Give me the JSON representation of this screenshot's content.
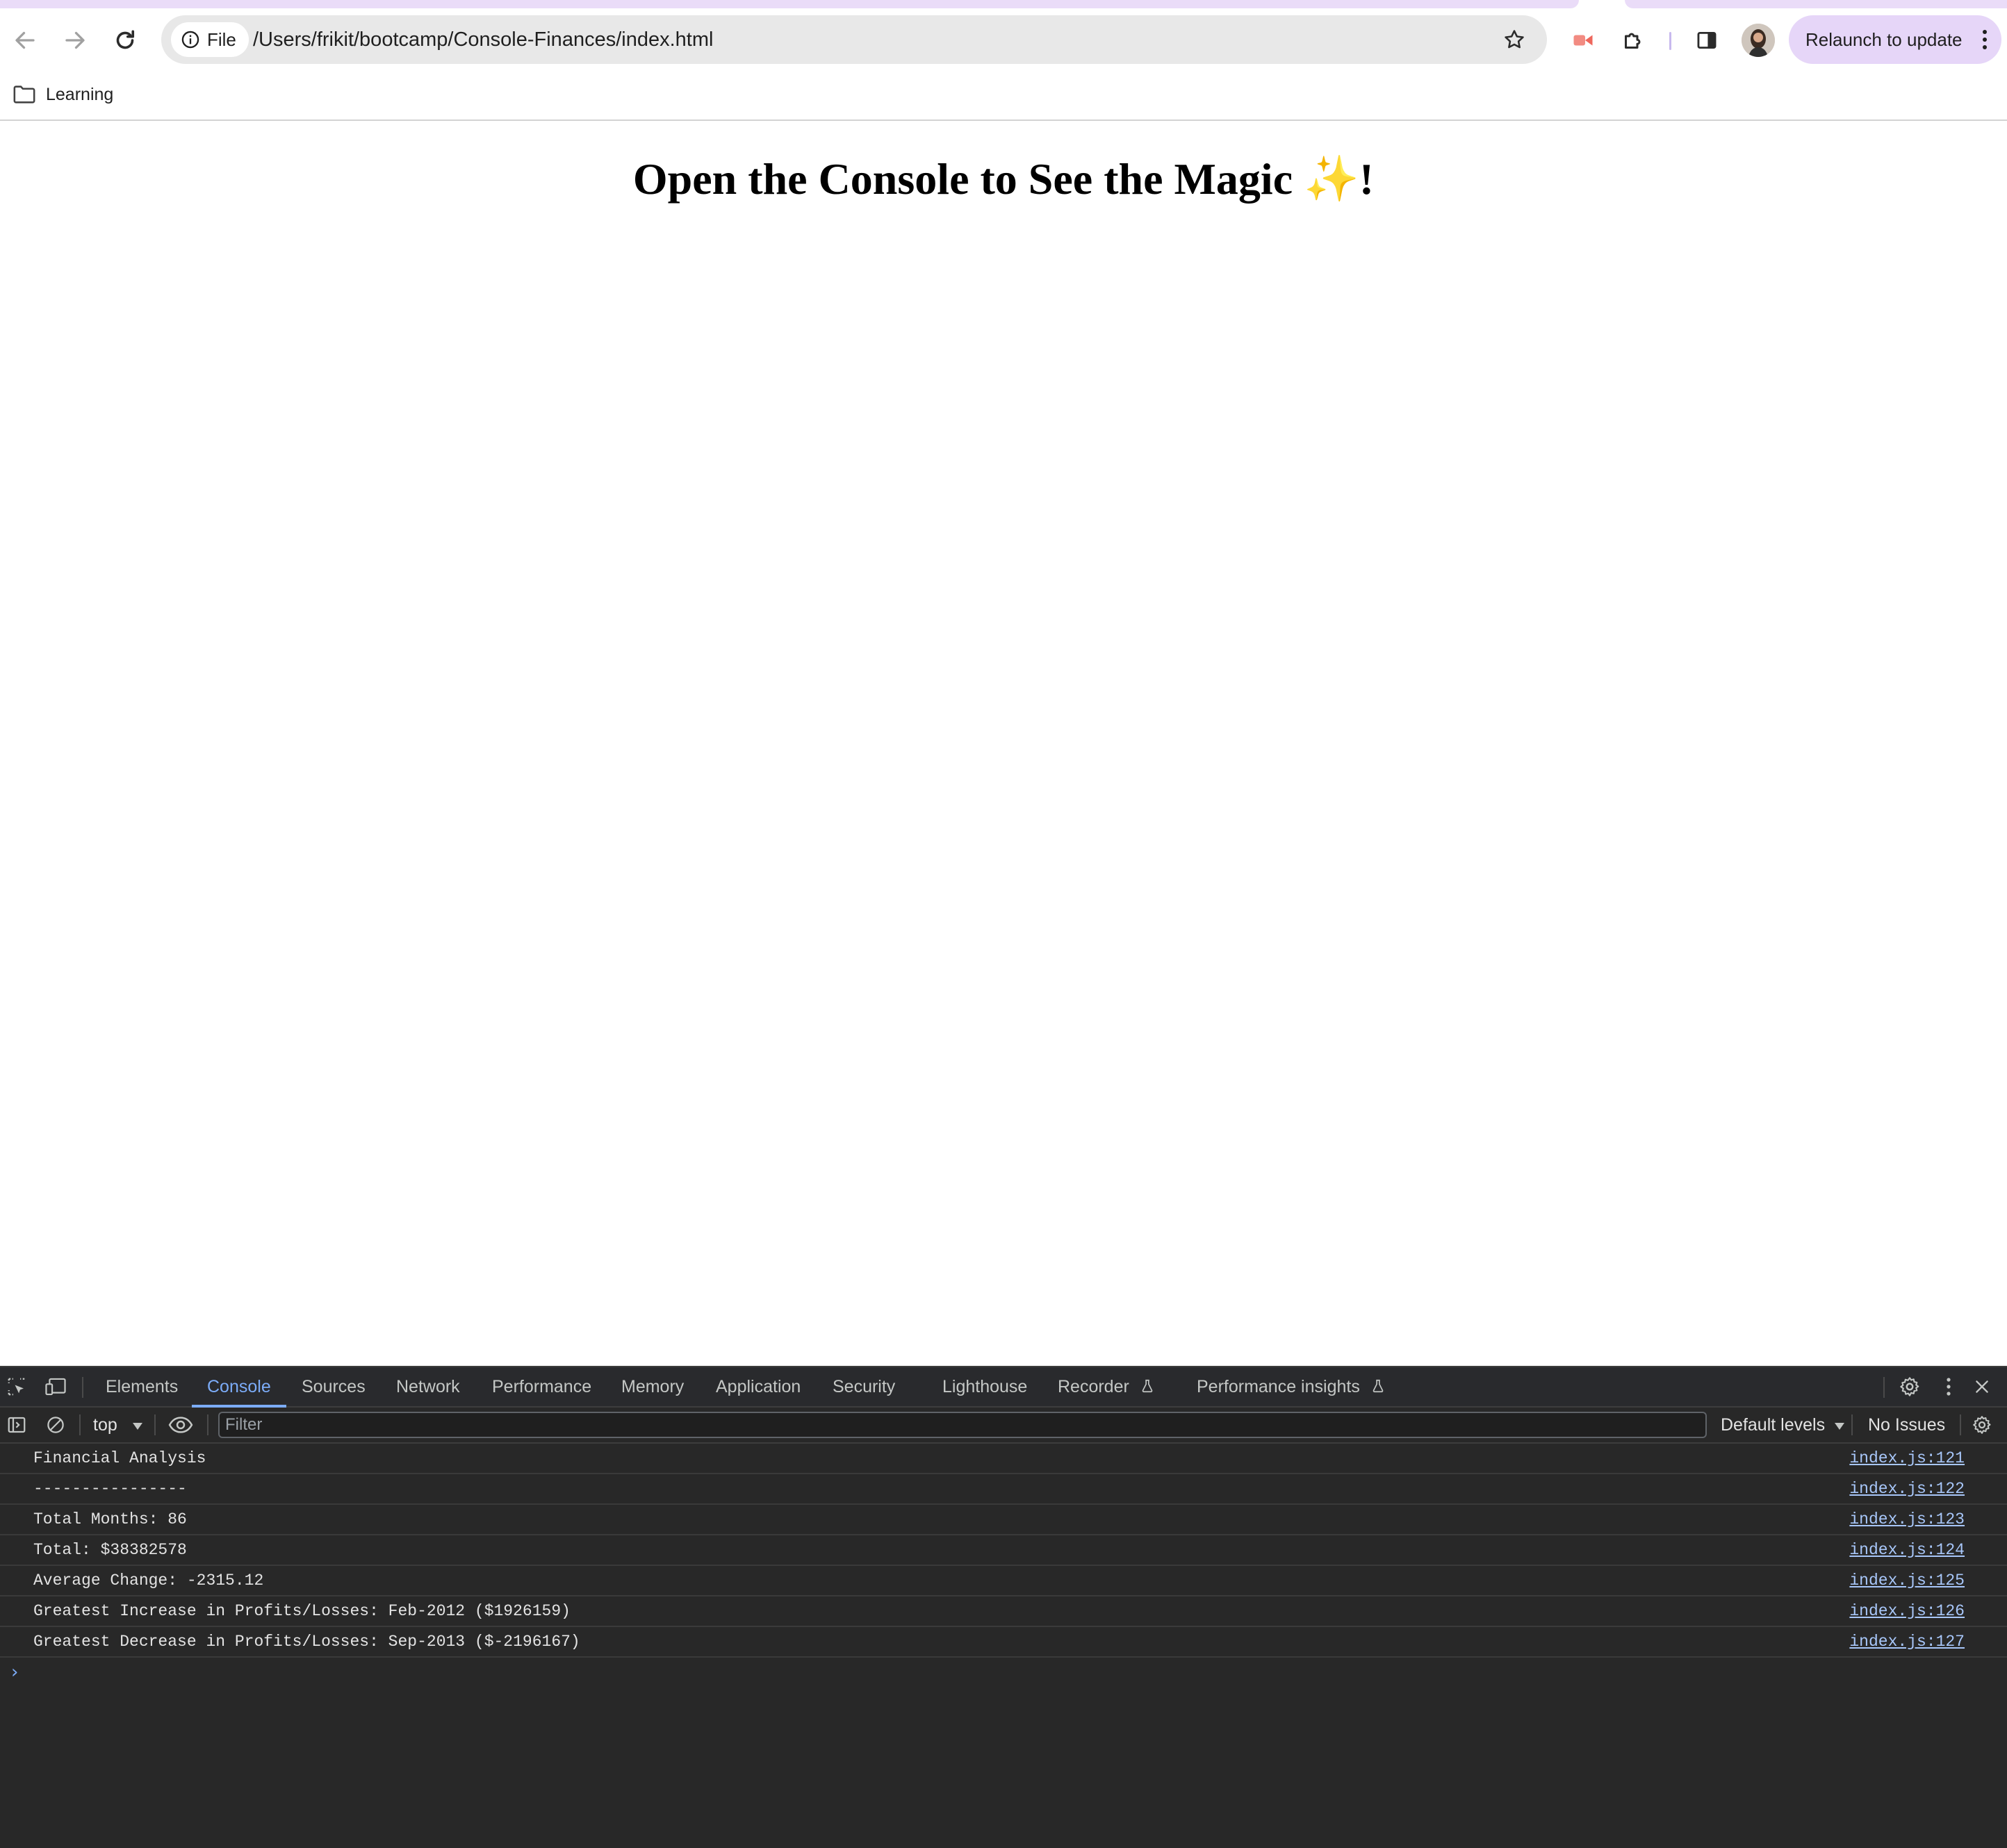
{
  "browser": {
    "site_info_label": "File",
    "url": "/Users/frikit/bootcamp/Console-Finances/index.html",
    "relaunch_label": "Relaunch to update",
    "bookmarks": [
      {
        "label": "Learning",
        "icon": "folder-icon"
      }
    ],
    "colors": {
      "accent": "#e6d6f8",
      "omnibox": "#e8e8e8"
    }
  },
  "page": {
    "heading_text": "Open the Console to See the Magic ",
    "heading_emoji": "✨",
    "heading_end": "!"
  },
  "devtools": {
    "tabs": [
      {
        "label": "Elements"
      },
      {
        "label": "Console",
        "active": true
      },
      {
        "label": "Sources"
      },
      {
        "label": "Network"
      },
      {
        "label": "Performance"
      },
      {
        "label": "Memory"
      },
      {
        "label": "Application"
      },
      {
        "label": "Security"
      },
      {
        "label": "Lighthouse"
      },
      {
        "label": "Recorder"
      },
      {
        "label": "Performance insights"
      }
    ],
    "context": "top",
    "filter_placeholder": "Filter",
    "levels": "Default levels",
    "issues": "No Issues",
    "console_rows": [
      {
        "message": "Financial Analysis",
        "source": "index.js:121"
      },
      {
        "message": "----------------",
        "source": "index.js:122"
      },
      {
        "message": "Total Months: 86",
        "source": "index.js:123"
      },
      {
        "message": "Total: $38382578",
        "source": "index.js:124"
      },
      {
        "message": "Average Change: -2315.12",
        "source": "index.js:125"
      },
      {
        "message": "Greatest Increase in Profits/Losses: Feb-2012 ($1926159)",
        "source": "index.js:126"
      },
      {
        "message": "Greatest Decrease in Profits/Losses: Sep-2013 ($-2196167)",
        "source": "index.js:127"
      }
    ],
    "colors": {
      "background": "#282828",
      "active_tab": "#7cacf8",
      "link": "#a8c7fa"
    }
  }
}
